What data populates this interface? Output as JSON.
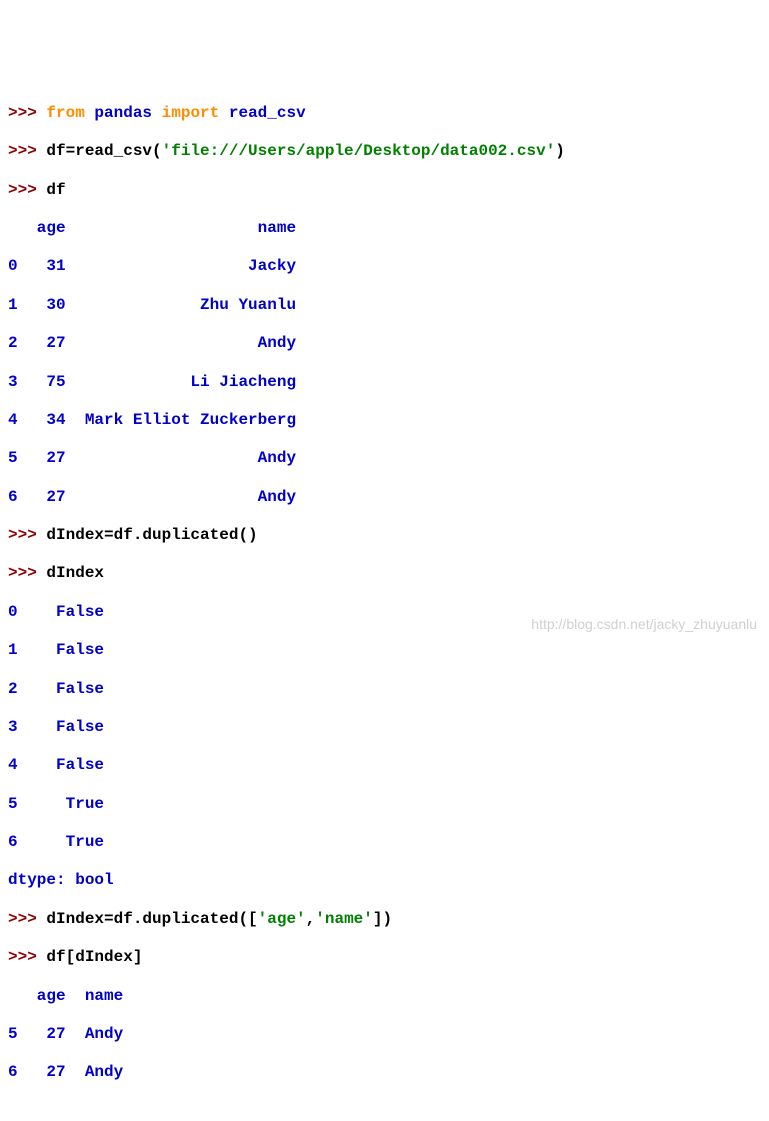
{
  "lines": {
    "l1_prompt": ">>> ",
    "l1_kw1": "from",
    "l1_sp1": " ",
    "l1_mod1": "pandas",
    "l1_sp2": " ",
    "l1_kw2": "import",
    "l1_sp3": " ",
    "l1_mod2": "read_csv",
    "l2_prompt": ">>> ",
    "l2_code": "df=read_csv(",
    "l2_str": "'file:///Users/apple/Desktop/data002.csv'",
    "l2_code2": ")",
    "l3_prompt": ">>> ",
    "l3_code": "df",
    "l4": "   age                    name",
    "l5": "0   31                   Jacky",
    "l6": "1   30              Zhu Yuanlu",
    "l7": "2   27                    Andy",
    "l8": "3   75             Li Jiacheng",
    "l9": "4   34  Mark Elliot Zuckerberg",
    "l10": "5   27                    Andy",
    "l11": "6   27                    Andy",
    "l12_prompt": ">>> ",
    "l12_code": "dIndex=df.duplicated()",
    "l13_prompt": ">>> ",
    "l13_code": "dIndex",
    "l14": "0    False",
    "l15": "1    False",
    "l16": "2    False",
    "l17": "3    False",
    "l18": "4    False",
    "l19": "5     True",
    "l20": "6     True",
    "l21": "dtype: bool",
    "l22_prompt": ">>> ",
    "l22_code1": "dIndex=df.duplicated([",
    "l22_str1": "'age'",
    "l22_code2": ",",
    "l22_str2": "'name'",
    "l22_code3": "])",
    "l23_prompt": ">>> ",
    "l23_code": "df[dIndex]",
    "l24": "   age  name",
    "l25": "5   27  Andy",
    "l26": "6   27  Andy"
  },
  "watermark": "http://blog.csdn.net/jacky_zhuyuanlu"
}
